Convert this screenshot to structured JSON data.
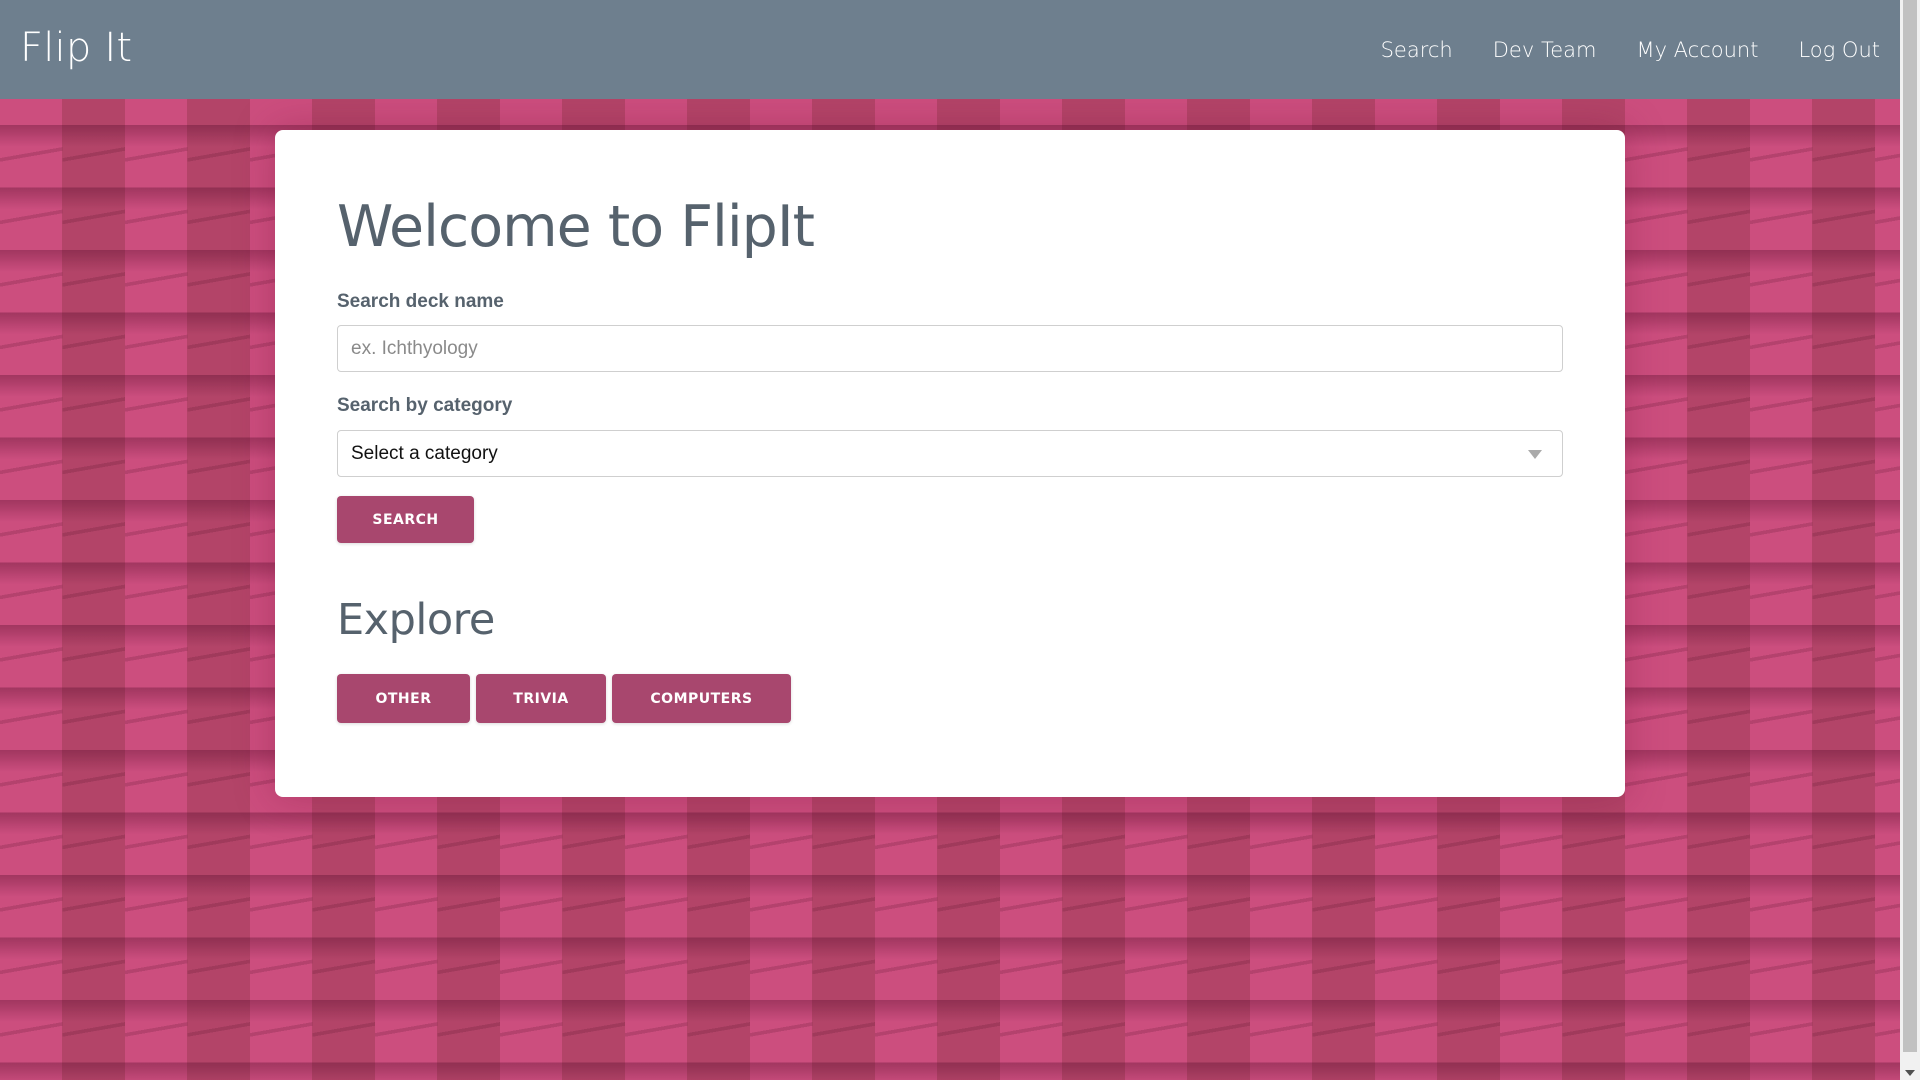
{
  "navbar": {
    "brand": "Flip It",
    "links": [
      {
        "label": "Search"
      },
      {
        "label": "Dev Team"
      },
      {
        "label": "My Account"
      },
      {
        "label": "Log Out"
      }
    ]
  },
  "main": {
    "title": "Welcome to FlipIt",
    "deck_search": {
      "label": "Search deck name",
      "value": "",
      "placeholder": "ex. Ichthyology"
    },
    "category_search": {
      "label": "Search by category",
      "selected": "Select a category"
    },
    "search_button_label": "SEARCH",
    "explore": {
      "title": "Explore",
      "categories": [
        {
          "label": "OTHER"
        },
        {
          "label": "TRIVIA"
        },
        {
          "label": "COMPUTERS"
        }
      ]
    }
  },
  "colors": {
    "navbar": "#6e7f8e",
    "accent": "#a8476e",
    "background": "#c84c7b",
    "heading_text": "#56626d"
  },
  "icons": {
    "select_arrow": "chevron-down-icon",
    "scroll_down": "scroll-down-arrow-icon"
  }
}
